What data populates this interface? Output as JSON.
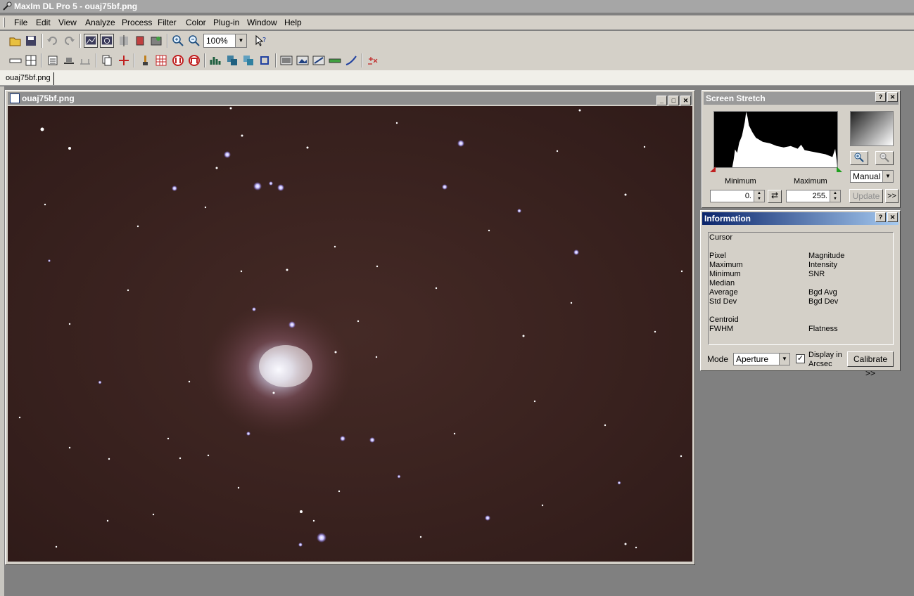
{
  "app": {
    "title": "MaxIm DL Pro 5 - ouaj75bf.png"
  },
  "menu": [
    {
      "label": "File"
    },
    {
      "label": "Edit"
    },
    {
      "label": "View"
    },
    {
      "label": "Analyze"
    },
    {
      "label": "Process"
    },
    {
      "label": "Filter"
    },
    {
      "label": "Color"
    },
    {
      "label": "Plug-in"
    },
    {
      "label": "Window"
    },
    {
      "label": "Help"
    }
  ],
  "toolbar": {
    "zoom_value": "100%"
  },
  "tabs": [
    {
      "label": "ouaj75bf.png"
    }
  ],
  "image_window": {
    "title": "ouaj75bf.png"
  },
  "screen_stretch": {
    "title": "Screen Stretch",
    "minimum_label": "Minimum",
    "maximum_label": "Maximum",
    "minimum_value": "0.",
    "maximum_value": "255.",
    "mode_value": "Manual",
    "update_label": "Update",
    "more_label": ">>"
  },
  "information": {
    "title": "Information",
    "cursor_label": "Cursor",
    "left_labels": [
      "Pixel",
      "Maximum",
      "Minimum",
      "Median",
      "Average",
      "Std Dev"
    ],
    "right_labels": [
      "Magnitude",
      "Intensity",
      "SNR",
      "",
      "Bgd Avg",
      "Bgd Dev"
    ],
    "centroid_label": "Centroid",
    "fwhm_label": "FWHM",
    "flatness_label": "Flatness",
    "mode_label": "Mode",
    "mode_value": "Aperture",
    "display_arcsec_label_1": "Display in",
    "display_arcsec_label_2": "Arcsec",
    "display_arcsec_checked": true,
    "calibrate_label": "Calibrate >>"
  },
  "colors": {
    "sky_background": "#3b2320",
    "title_active": "#0a246a",
    "chrome": "#d4d0c8"
  }
}
